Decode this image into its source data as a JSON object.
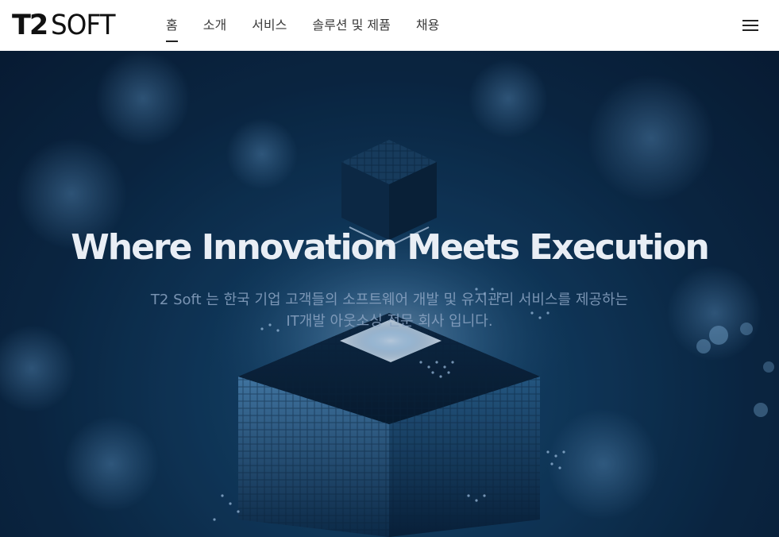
{
  "header": {
    "logo": {
      "bold": "T2",
      "light": "SOFT"
    },
    "nav": [
      {
        "label": "홈",
        "active": true
      },
      {
        "label": "소개",
        "active": false
      },
      {
        "label": "서비스",
        "active": false
      },
      {
        "label": "솔루션 및 제품",
        "active": false
      },
      {
        "label": "채용",
        "active": false
      }
    ],
    "menu_icon": "hamburger-menu-icon"
  },
  "hero": {
    "title": "Where Innovation Meets Execution",
    "subtitle_line1": "T2 Soft 는 한국 기업 고객들의 소프트웨어 개발 및 유지관리 서비스를 제공하는",
    "subtitle_line2": "IT개발 아웃소싱 전문 회사 입니다.",
    "image": "glowing-microchip-cube-background"
  },
  "colors": {
    "header_bg": "#ffffff",
    "nav_text": "#3a3a3a",
    "hero_dark": "#081b33",
    "hero_accent": "#1b4f78",
    "title_text": "#e9eef5"
  }
}
